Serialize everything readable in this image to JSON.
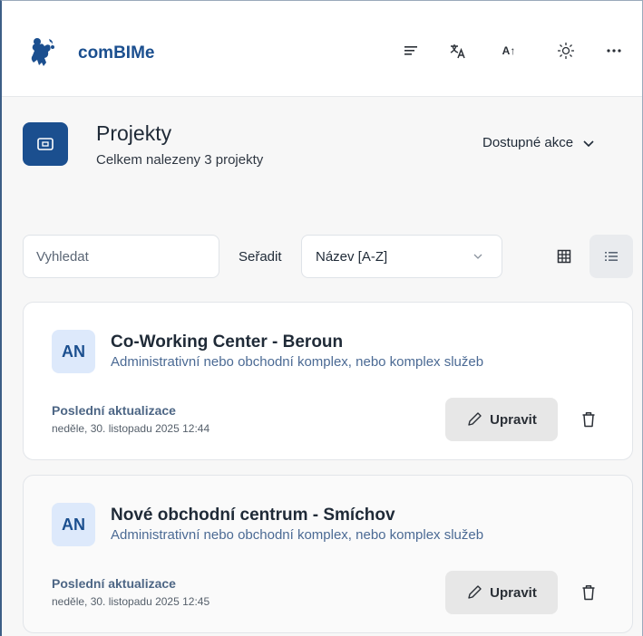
{
  "app": {
    "brand": "comBIMe"
  },
  "header": {
    "icons": [
      "menu-icon",
      "translate-icon",
      "text-size-icon",
      "theme-sun-icon",
      "more-icon"
    ],
    "text_size_glyph": "A↑"
  },
  "page": {
    "title": "Projekty",
    "subtitle": "Celkem nalezeny 3 projekty",
    "actions_label": "Dostupné akce"
  },
  "toolbar": {
    "search_placeholder": "Vyhledat",
    "search_value": "",
    "sort_label": "Seřadit",
    "sort_value": "Název [A-Z]",
    "active_view": "list"
  },
  "projects": [
    {
      "initials": "AN",
      "name": "Co-Working Center - Beroun",
      "type": "Administrativní nebo obchodní komplex, nebo komplex služeb",
      "updated_label": "Poslední aktualizace",
      "updated_value": "neděle, 30. listopadu 2025 12:44",
      "edit_label": "Upravit"
    },
    {
      "initials": "AN",
      "name": "Nové obchodní centrum - Smíchov",
      "type": "Administrativní nebo obchodní komplex, nebo komplex služeb",
      "updated_label": "Poslední aktualizace",
      "updated_value": "neděle, 30. listopadu 2025 12:45",
      "edit_label": "Upravit"
    }
  ],
  "colors": {
    "brand": "#1b4f8f",
    "avatar_bg": "#dde9fb",
    "muted_link": "#4b6a94"
  }
}
